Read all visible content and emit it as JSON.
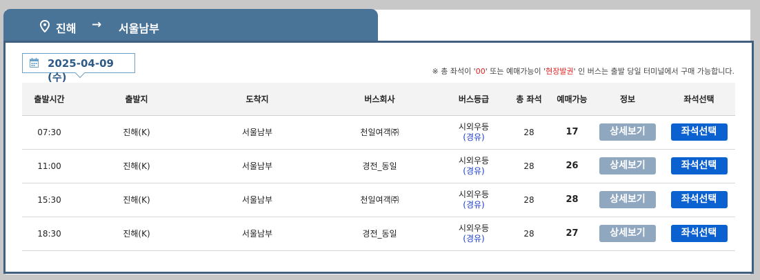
{
  "route": {
    "from": "진해",
    "arrow": "→",
    "to": "서울남부"
  },
  "date": "2025-04-09 (수)",
  "notice": {
    "part1": "※ 총 좌석이 '",
    "zero": "00",
    "part2": "' 또는 예매가능이 '",
    "onsite": "현장발권",
    "part3": "' 인 버스는 출발 당일 터미널에서 구매 가능합니다."
  },
  "table": {
    "headers": [
      "출발시간",
      "출발지",
      "도착지",
      "버스회사",
      "버스등급",
      "총 좌석",
      "예매가능",
      "정보",
      "좌석선택"
    ],
    "rows": [
      {
        "time": "07:30",
        "departure": "진해(K)",
        "arrival": "서울남부",
        "company": "천일여객㈜",
        "grade": "시외우등",
        "via": "(경유)",
        "total": "28",
        "available": "17",
        "detail": "상세보기",
        "select": "좌석선택"
      },
      {
        "time": "11:00",
        "departure": "진해(K)",
        "arrival": "서울남부",
        "company": "경전_동일",
        "grade": "시외우등",
        "via": "(경유)",
        "total": "28",
        "available": "26",
        "detail": "상세보기",
        "select": "좌석선택"
      },
      {
        "time": "15:30",
        "departure": "진해(K)",
        "arrival": "서울남부",
        "company": "천일여객㈜",
        "grade": "시외우등",
        "via": "(경유)",
        "total": "28",
        "available": "28",
        "detail": "상세보기",
        "select": "좌석선택"
      },
      {
        "time": "18:30",
        "departure": "진해(K)",
        "arrival": "서울남부",
        "company": "경전_동일",
        "grade": "시외우등",
        "via": "(경유)",
        "total": "28",
        "available": "27",
        "detail": "상세보기",
        "select": "좌석선택"
      }
    ]
  },
  "colors": {
    "tab": "#4a7398",
    "panel_border": "#3e5f7f",
    "detail_button": "#8fa7bf",
    "select_button": "#0b61d0",
    "notice_highlight": "#e02020",
    "via_text": "#1a3cc8"
  }
}
